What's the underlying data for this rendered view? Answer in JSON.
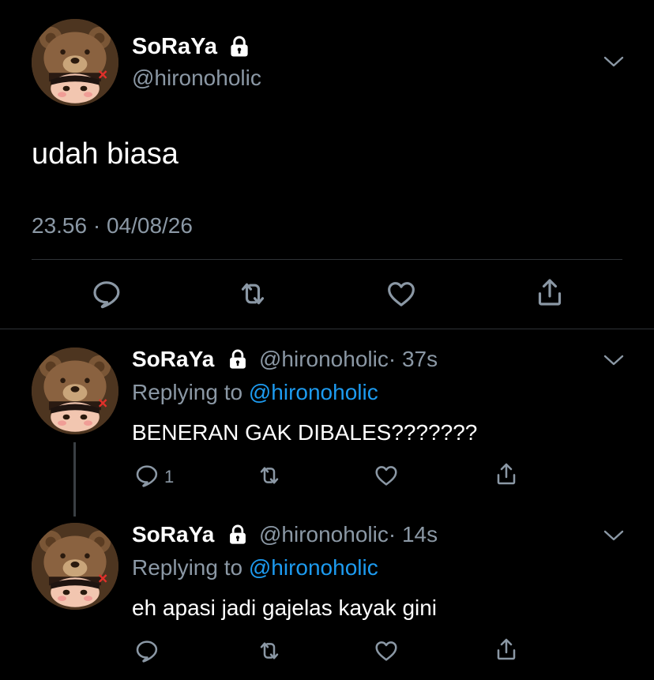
{
  "main_tweet": {
    "display_name": "SoRaYa",
    "handle": "@hironoholic",
    "text": "udah biasa",
    "timestamp": "23.56 · 04/08/26",
    "actions": [
      "reply-icon",
      "retweet-icon",
      "like-icon",
      "share-icon"
    ]
  },
  "replies": [
    {
      "display_name": "SoRaYa",
      "handle": "@hironoholic",
      "time": "· 37s",
      "replying_prefix": "Replying to",
      "replying_handle": "@hironoholic",
      "text": "BENERAN GAK DIBALES???????",
      "reply_count": "1"
    },
    {
      "display_name": "SoRaYa",
      "handle": "@hironoholic",
      "time": "· 14s",
      "replying_prefix": "Replying to",
      "replying_handle": "@hironoholic",
      "text": "eh apasi jadi gajelas kayak gini",
      "reply_count": ""
    }
  ],
  "colors": {
    "background": "#000000",
    "text": "#ffffff",
    "muted": "#8b98a5",
    "link": "#1d9bf0",
    "divider": "#2f3336"
  }
}
